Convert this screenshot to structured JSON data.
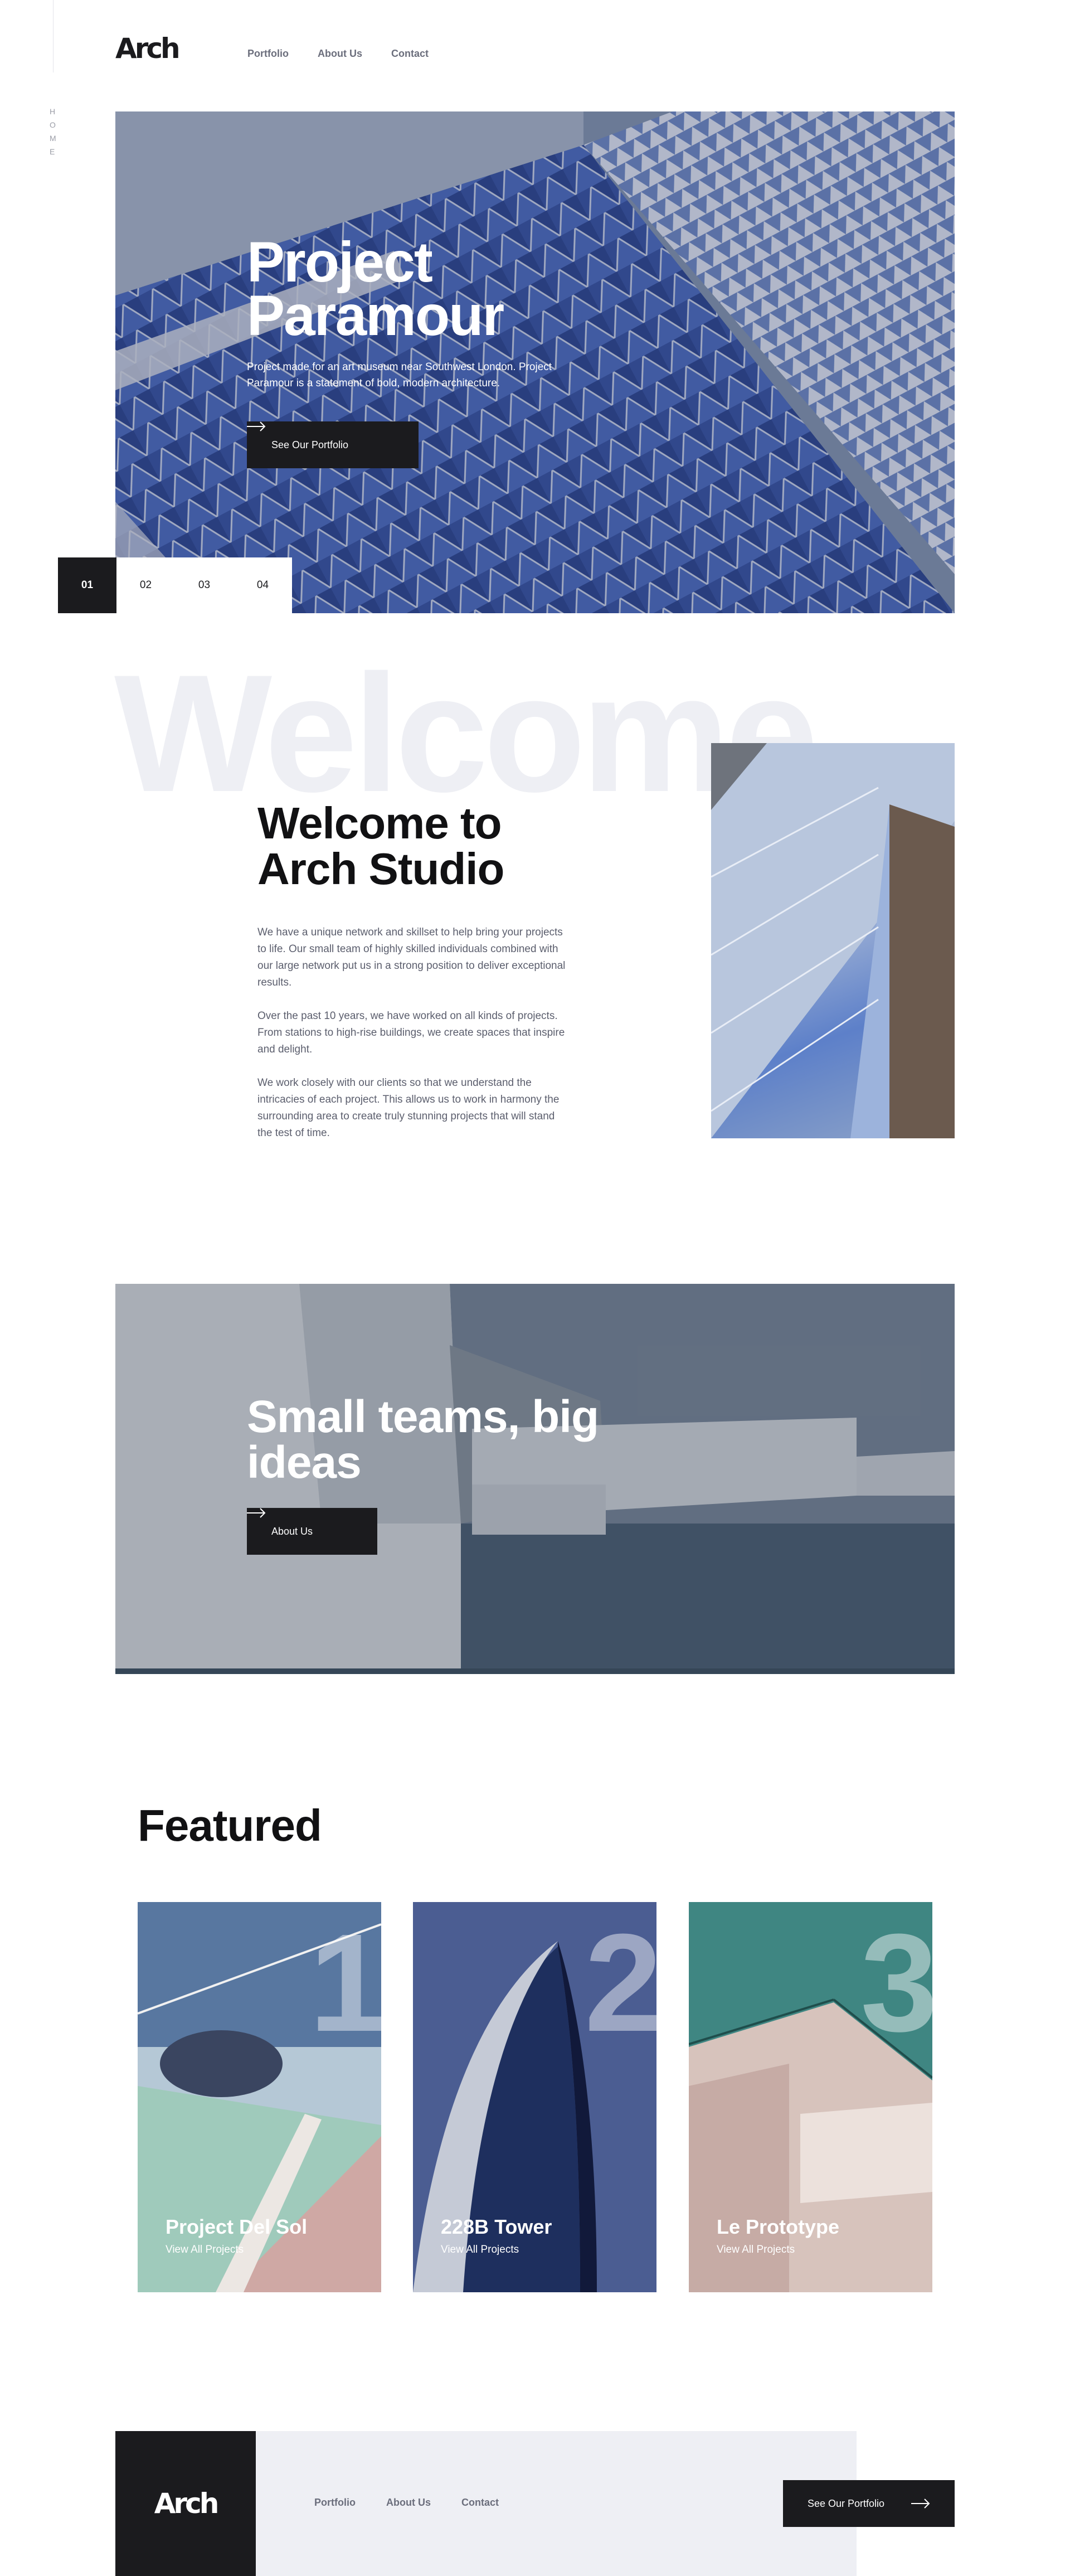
{
  "sidebar": {
    "vertical_label": "HOME"
  },
  "header": {
    "logo": "Arch",
    "nav": [
      "Portfolio",
      "About Us",
      "Contact"
    ]
  },
  "hero": {
    "title": "Project Paramour",
    "description": "Project made for an art museum near Southwest London. Project Paramour is a statement of bold, modern architecture.",
    "button_label": "See Our Portfolio",
    "slides": [
      "01",
      "02",
      "03",
      "04"
    ],
    "active_slide": "01"
  },
  "welcome": {
    "background_word": "Welcome",
    "title": "Welcome to Arch Studio",
    "paragraphs": [
      "We have a unique network and skillset to help bring your projects to life. Our small team of highly skilled individuals combined with our large network put us in a strong position to deliver exceptional results.",
      "Over the past 10 years, we have worked on all kinds of projects. From stations to high-rise buildings, we create spaces that inspire and delight.",
      "We work closely with our clients so that we understand the intricacies of each project. This allows us to work in harmony the surrounding area to create truly stunning projects that will stand the test of time."
    ]
  },
  "teams": {
    "title": "Small teams, big ideas",
    "button_label": "About Us"
  },
  "featured": {
    "title": "Featured",
    "cards": [
      {
        "number": "1",
        "name": "Project Del Sol",
        "link": "View All Projects"
      },
      {
        "number": "2",
        "name": "228B Tower",
        "link": "View All Projects"
      },
      {
        "number": "3",
        "name": "Le Prototype",
        "link": "View All Projects"
      }
    ]
  },
  "footer": {
    "logo": "Arch",
    "nav": [
      "Portfolio",
      "About Us",
      "Contact"
    ],
    "button_label": "See Our Portfolio"
  },
  "colors": {
    "dark": "#1b1b1e",
    "light_gray": "#eeeff4",
    "nav_gray": "#6b6e7c",
    "body_text": "#5b5e6d"
  }
}
